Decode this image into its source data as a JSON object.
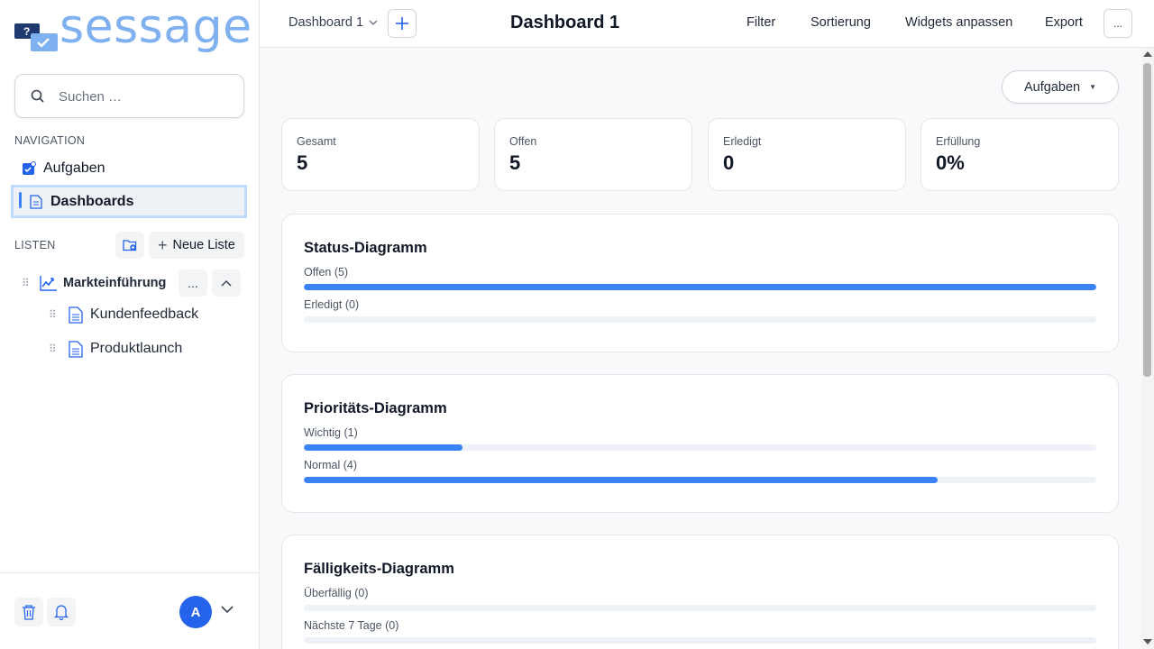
{
  "app": {
    "logo_text": "sessage"
  },
  "sidebar": {
    "search_placeholder": "Suchen …",
    "navigation_label": "NAVIGATION",
    "nav": [
      {
        "label": "Aufgaben",
        "icon": "tasks-icon"
      },
      {
        "label": "Dashboards",
        "icon": "document-icon",
        "active": true
      }
    ],
    "lists_label": "LISTEN",
    "new_list_label": "Neue Liste",
    "tree": {
      "parent": {
        "label": "Markteinführung",
        "icon": "chart-trend-icon",
        "more": "..."
      },
      "children": [
        {
          "label": "Kundenfeedback",
          "icon": "document-icon"
        },
        {
          "label": "Produktlaunch",
          "icon": "document-icon"
        }
      ]
    },
    "user_initial": "A"
  },
  "topbar": {
    "dashboard_select": "Dashboard 1",
    "title": "Dashboard 1",
    "actions": [
      "Filter",
      "Sortierung",
      "Widgets anpassen",
      "Export"
    ],
    "more": "..."
  },
  "main": {
    "tasks_button": "Aufgaben",
    "kpis": [
      {
        "label": "Gesamt",
        "value": "5"
      },
      {
        "label": "Offen",
        "value": "5"
      },
      {
        "label": "Erledigt",
        "value": "0"
      },
      {
        "label": "Erfüllung",
        "value": "0%"
      }
    ],
    "widgets": [
      {
        "title": "Status-Diagramm",
        "rows": [
          {
            "label": "Offen (5)",
            "fraction": 1.0
          },
          {
            "label": "Erledigt (0)",
            "fraction": 0.0
          }
        ]
      },
      {
        "title": "Prioritäts-Diagramm",
        "rows": [
          {
            "label": "Wichtig (1)",
            "fraction": 0.2
          },
          {
            "label": "Normal (4)",
            "fraction": 0.8
          }
        ]
      },
      {
        "title": "Fälligkeits-Diagramm",
        "rows": [
          {
            "label": "Überfällig (0)",
            "fraction": 0.0
          },
          {
            "label": "Nächste 7 Tage (0)",
            "fraction": 0.0
          }
        ]
      }
    ]
  },
  "colors": {
    "accent": "#3b82f6",
    "avatar": "#2563eb",
    "logo": "#7fb0f0",
    "track": "#eef1f5"
  }
}
